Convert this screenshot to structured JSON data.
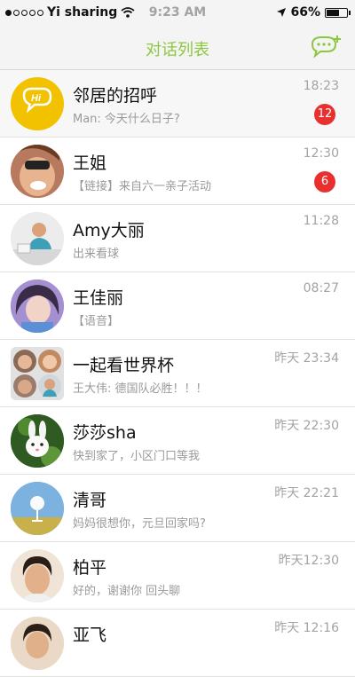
{
  "status_bar": {
    "carrier": "Yi sharing",
    "time": "9:23 AM",
    "battery": "66%",
    "battery_level": 0.66,
    "signal_bars_filled": 1,
    "signal_bars_total": 5
  },
  "nav": {
    "title": "对话列表",
    "compose_icon": "add-chat-icon",
    "accent_color": "#8dc63f"
  },
  "conversations": [
    {
      "name": "邻居的招呼",
      "preview": "Man: 今天什么日子?",
      "time": "18:23",
      "badge": "12"
    },
    {
      "name": "王姐",
      "preview": "【链接】来自六一亲子活动",
      "time": "12:30",
      "badge": "6"
    },
    {
      "name": "Amy大丽",
      "preview": "出来看球",
      "time": "11:28",
      "badge": ""
    },
    {
      "name": "王佳丽",
      "preview": "【语音】",
      "time": "08:27",
      "badge": ""
    },
    {
      "name": "一起看世界杯",
      "preview": "王大伟: 德国队必胜！！！",
      "time": "昨天 23:34",
      "badge": ""
    },
    {
      "name": "莎莎sha",
      "preview": "快到家了，小区门口等我",
      "time": "昨天 22:30",
      "badge": ""
    },
    {
      "name": "清哥",
      "preview": "妈妈很想你，元旦回家吗?",
      "time": "昨天 22:21",
      "badge": ""
    },
    {
      "name": "柏平",
      "preview": "好的，谢谢你 回头聊",
      "time": "昨天12:30",
      "badge": ""
    },
    {
      "name": "亚飞",
      "preview": "",
      "time": "昨天 12:16",
      "badge": ""
    }
  ],
  "badge_color": "#e8312f"
}
